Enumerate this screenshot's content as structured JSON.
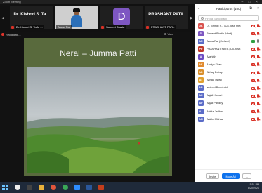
{
  "window": {
    "title": "Zoom Meeting",
    "buttons": [
      "–",
      "□",
      "×"
    ]
  },
  "video_strip": {
    "tiles": [
      {
        "name_big": "Dr. Kishori S. Ta...",
        "name": "Dr. Kishori S. Tarfe ...",
        "type": "text"
      },
      {
        "name": "Aruna Rai",
        "type": "video"
      },
      {
        "name": "Sumeet Bhatia",
        "initial": "D",
        "type": "avatar"
      },
      {
        "name_big": "PRASHANT PATIL",
        "name": "PRASHANT PATIL",
        "type": "text"
      }
    ]
  },
  "recording": {
    "label": "Recording..."
  },
  "speaker_view": {
    "label": "⊞ View"
  },
  "slide": {
    "title": "Neral – Jumma Patti"
  },
  "participants": {
    "header": "Participants (100)",
    "search_placeholder": "Find a participant",
    "list": [
      {
        "initials": "DK",
        "name": "Dr. Kishori S... (Co-host, me)",
        "color": "#d9534f",
        "mic": "off",
        "cam": "off"
      },
      {
        "initials": "D",
        "name": "Sumeet Bhatia (Host)",
        "color": "#7e57c2",
        "mic": "off",
        "cam": "off"
      },
      {
        "initials": "AR",
        "name": "Aruna Rai (Co-host)",
        "color": "#5b6cc7",
        "mic": "on",
        "cam": "on"
      },
      {
        "initials": "PP",
        "name": "PRASHANT PATIL (Co-host)",
        "color": "#c0392b",
        "mic": "off",
        "cam": "off"
      },
      {
        "initials": "A",
        "name": "Aashish",
        "color": "#6d4cc2",
        "mic": "off",
        "cam": "off"
      },
      {
        "initials": "AK",
        "name": "Aaniya Khan",
        "color": "#e08a2e",
        "mic": "off",
        "cam": "off"
      },
      {
        "initials": "AD",
        "name": "Abhay Dubey",
        "color": "#d98f2b",
        "mic": "off",
        "cam": "off"
      },
      {
        "initials": "AT",
        "name": "Abhay Tiwari",
        "color": "#e0a030",
        "mic": "off",
        "cam": "off"
      },
      {
        "initials": "AB",
        "name": "android Bluedroid",
        "color": "#5b6cc7",
        "mic": "off",
        "cam": "off"
      },
      {
        "initials": "AK",
        "name": "Anjali Kumari",
        "color": "#5b6cc7",
        "mic": "off",
        "cam": "off"
      },
      {
        "initials": "AP",
        "name": "Anjali Pandey",
        "color": "#5b6cc7",
        "mic": "off",
        "cam": "off"
      },
      {
        "initials": "AJ",
        "name": "Ankita Jadhav",
        "color": "#5b6cc7",
        "mic": "off",
        "cam": "off"
      },
      {
        "initials": "AM",
        "name": "Ankita Mishra",
        "color": "#5b6cc7",
        "mic": "off",
        "cam": "off"
      }
    ],
    "footer": {
      "invite": "Invite",
      "mute_all": "Mute All",
      "more": "..."
    }
  },
  "taskbar": {
    "time": "5:51 PM",
    "date": "8/20/2021"
  }
}
